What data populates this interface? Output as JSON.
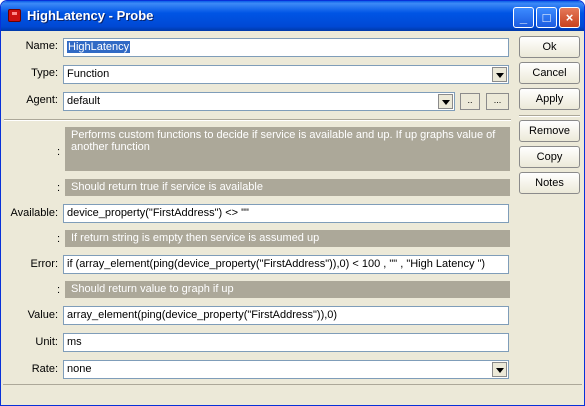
{
  "window": {
    "title": "HighLatency - Probe"
  },
  "fields": {
    "name": {
      "label": "Name:",
      "value": "HighLatency"
    },
    "type": {
      "label": "Type:",
      "value": "Function"
    },
    "agent": {
      "label": "Agent:",
      "value": "default",
      "btn1": "..",
      "btn2": "..."
    },
    "available": {
      "label": "Available:",
      "value": "device_property(\"FirstAddress\") <> \"\""
    },
    "error": {
      "label": "Error:",
      "value": "if (array_element(ping(device_property(\"FirstAddress\")),0) < 100 , \"\" , \"High Latency \")"
    },
    "value": {
      "label": "Value:",
      "value": "array_element(ping(device_property(\"FirstAddress\")),0)"
    },
    "unit": {
      "label": "Unit:",
      "value": "ms"
    },
    "rate": {
      "label": "Rate:",
      "value": "none"
    }
  },
  "descriptions": {
    "colon": ":",
    "probe": "Performs custom functions to decide if service is available and up. If up graphs value of another function",
    "available": "Should return true if service is available",
    "error": "If return string is empty then service is assumed up",
    "value": "Should return value to graph if up"
  },
  "buttons": {
    "ok": "Ok",
    "cancel": "Cancel",
    "apply": "Apply",
    "remove": "Remove",
    "copy": "Copy",
    "notes": "Notes"
  },
  "title_buttons": {
    "minimize": "_",
    "maximize": "□",
    "close": "×"
  }
}
